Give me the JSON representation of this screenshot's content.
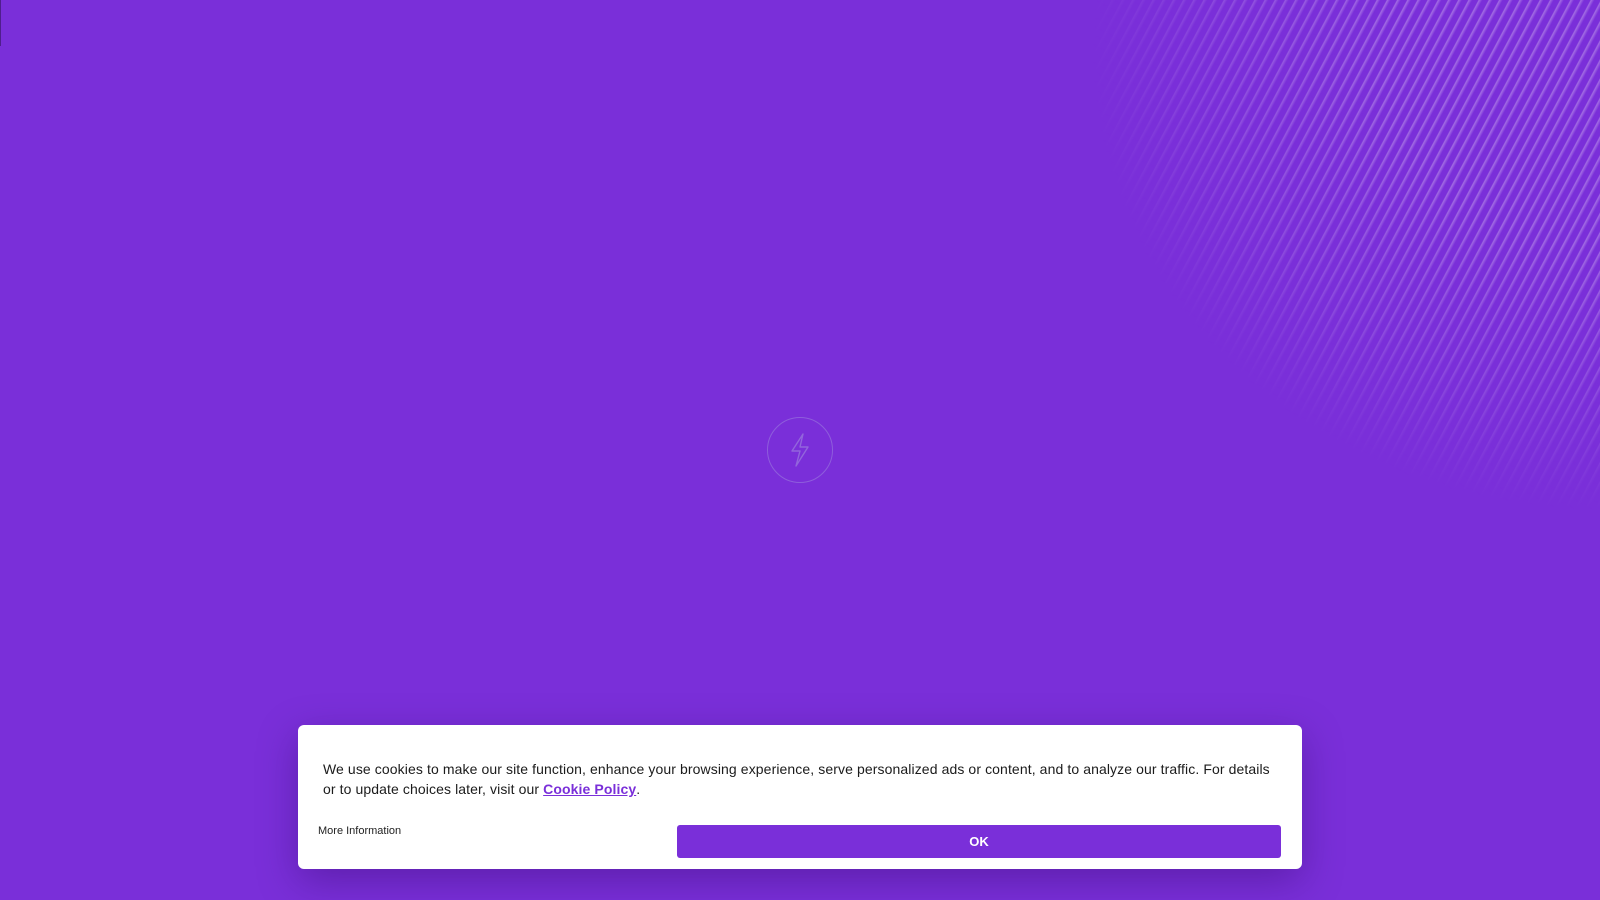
{
  "colors": {
    "brand": "#7a2fd9",
    "banner_background": "#ffffff",
    "text": "#1b1b1b"
  },
  "hero": {
    "logo_icon": "lightning-bolt-icon"
  },
  "cookie_banner": {
    "message_prefix": "We use cookies to make our site function, enhance your browsing experience, serve personalized ads or content, and to analyze our traffic. For details or to update choices later, visit our ",
    "policy_link_label": "Cookie Policy",
    "message_suffix": ".",
    "more_info_label": "More Information",
    "ok_label": "OK"
  }
}
